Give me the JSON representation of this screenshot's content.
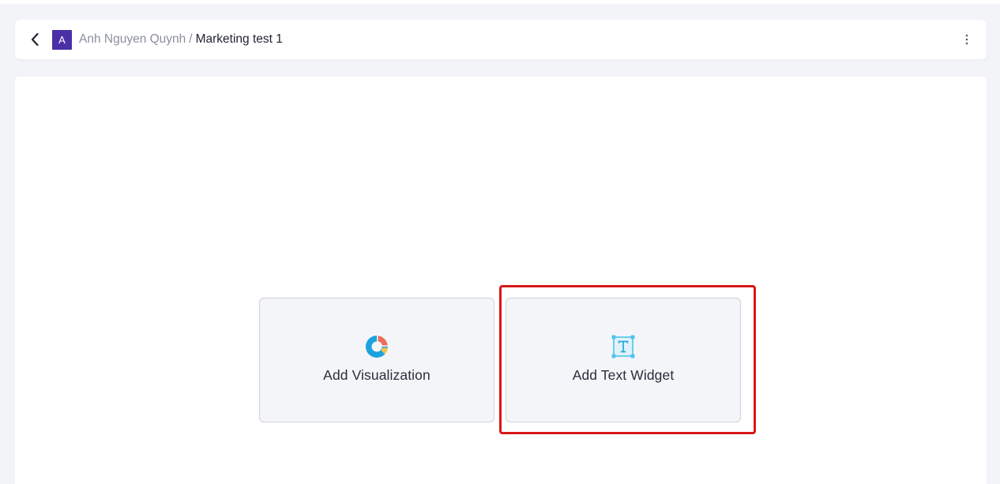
{
  "header": {
    "avatar_letter": "A",
    "owner_name": "Anh Nguyen Quynh",
    "separator": "/",
    "dashboard_name": "Marketing test 1",
    "back_icon": "chevron-left-icon",
    "more_icon": "vertical-dots-icon"
  },
  "cards": {
    "visualization": {
      "label": "Add Visualization",
      "icon": "donut-chart-icon"
    },
    "text_widget": {
      "label": "Add Text Widget",
      "icon": "text-box-icon"
    }
  },
  "colors": {
    "avatar_bg": "#4b2fa7",
    "highlight": "#d81818",
    "chart_blue": "#1aa3dc",
    "chart_red": "#f06a5a",
    "chart_yellow": "#f6c34a",
    "text_icon": "#4fc3ef"
  }
}
